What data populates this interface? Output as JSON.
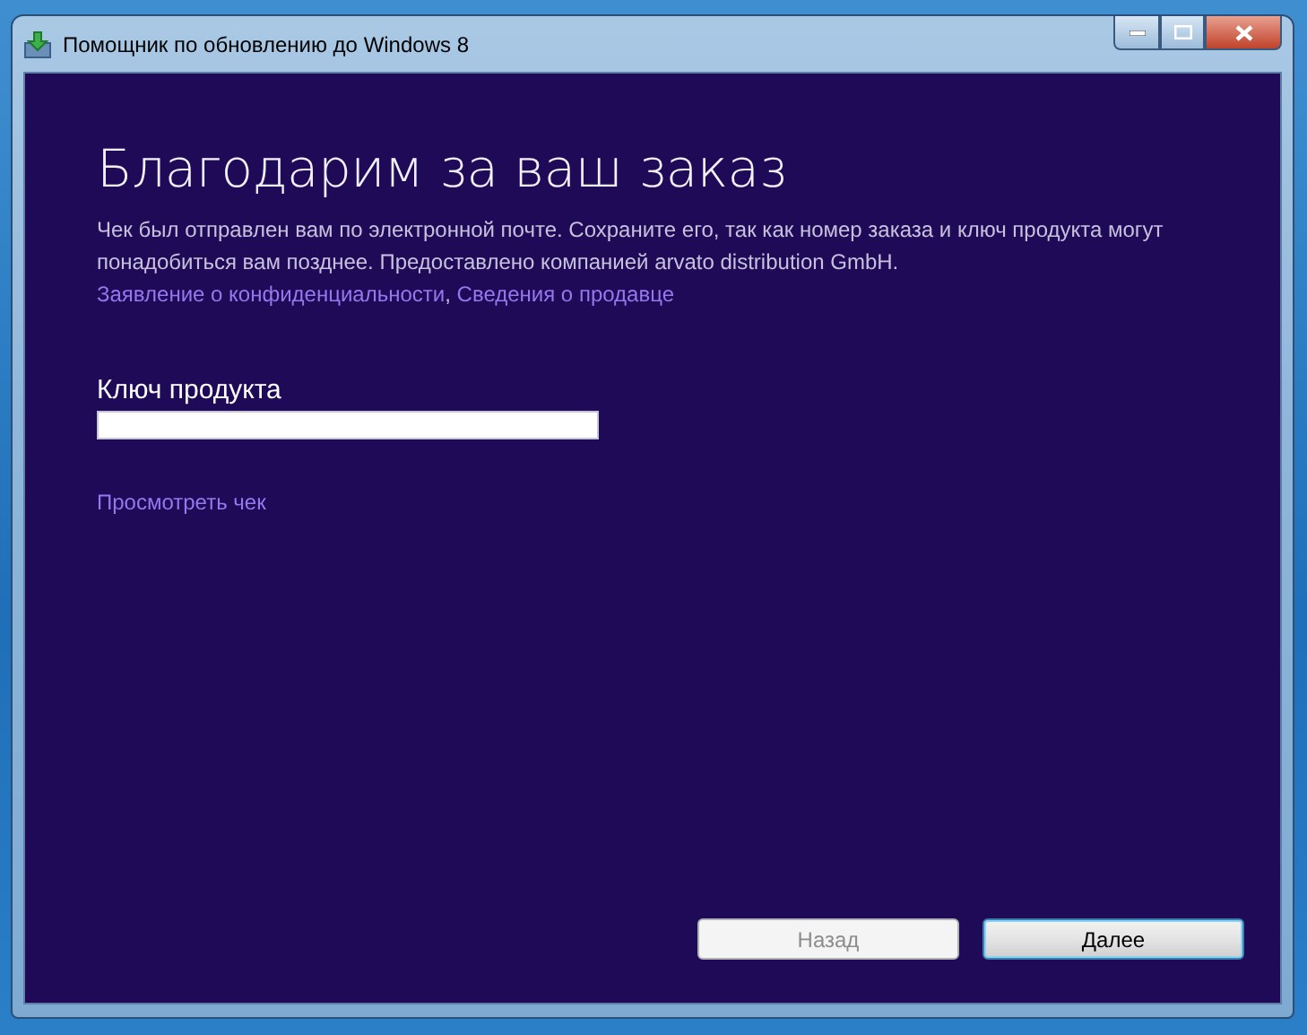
{
  "window": {
    "title": "Помощник по обновлению до Windows 8"
  },
  "heading": "Благодарим за ваш заказ",
  "description": {
    "text": "Чек был отправлен вам по электронной почте. Сохраните его, так как номер заказа и ключ продукта могут понадобиться вам позднее.  Предоставлено компанией arvato distribution GmbH.",
    "links": [
      "Заявление о конфиденциальности",
      "Сведения о продавце"
    ],
    "separator": ","
  },
  "product_key": {
    "label": "Ключ продукта"
  },
  "view_receipt_link": "Просмотреть чек",
  "buttons": [
    {
      "label": "Назад",
      "disabled": true,
      "default": false
    },
    {
      "label": "Далее",
      "disabled": false,
      "default": true
    }
  ]
}
